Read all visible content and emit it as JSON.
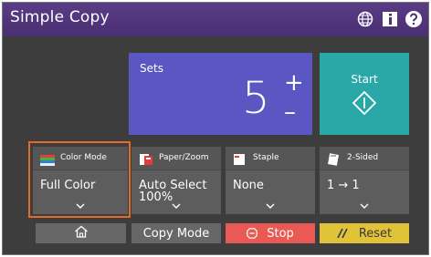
{
  "titlebar": {
    "title": "Simple Copy",
    "icons": [
      "globe-icon",
      "info-icon",
      "help-icon"
    ]
  },
  "sets": {
    "label": "Sets",
    "value": "5",
    "plus": "+",
    "minus": "–"
  },
  "start": {
    "label": "Start",
    "icon": "start-diamond-icon"
  },
  "functions": [
    {
      "label": "Color Mode",
      "value": "Full Color",
      "icon": "color-mode-icon",
      "selected": true
    },
    {
      "label": "Paper/Zoom",
      "value_line1": "Auto Select",
      "value_line2": "100%",
      "icon": "paper-zoom-icon"
    },
    {
      "label": "Staple",
      "value": "None",
      "icon": "staple-icon"
    },
    {
      "label": "2-Sided",
      "value": "1 → 1",
      "icon": "two-sided-icon"
    }
  ],
  "bottom": {
    "home_icon": "home-icon",
    "copy_mode": "Copy Mode",
    "stop": "Stop",
    "reset": "Reset"
  },
  "colors": {
    "titlebar": "#4a2f73",
    "sets_panel": "#5a56c2",
    "start_button": "#2aa8a8",
    "selection_ring": "#e36a2b",
    "stop_button": "#ea5a55",
    "reset_button": "#e1c33a",
    "background": "#3d3d3d"
  }
}
